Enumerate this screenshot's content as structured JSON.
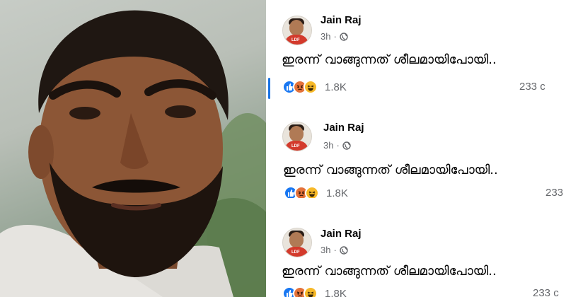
{
  "photo": {
    "alt_subject": "man-portrait"
  },
  "posts": [
    {
      "author": "Jain Raj",
      "time": "3h",
      "separator": "·",
      "text": "ഇരന്ന് വാങ്ങുന്നത് ശീലമായിപോയി..",
      "reaction_count": "1.8K",
      "comments": "233 c",
      "avatar_tag": "LDF"
    },
    {
      "author": "Jain Raj",
      "time": "3h",
      "separator": "·",
      "text": "ഇരന്ന് വാങ്ങുന്നത് ശീലമായിപോയി..",
      "reaction_count": "1.8K",
      "comments": "233",
      "avatar_tag": "LDF"
    },
    {
      "author": "Jain Raj",
      "time": "3h",
      "separator": "·",
      "text": "ഇരന്ന് വാങ്ങുന്നത് ശീലമായിപോയി..",
      "reaction_count": "1.8K",
      "comments": "233 c",
      "avatar_tag": "LDF"
    }
  ],
  "colors": {
    "like": "#1877f2",
    "angry": "#e4723a",
    "haha": "#f7b928",
    "meta_text": "#65676b",
    "accent_bar": "#1b74e4"
  }
}
